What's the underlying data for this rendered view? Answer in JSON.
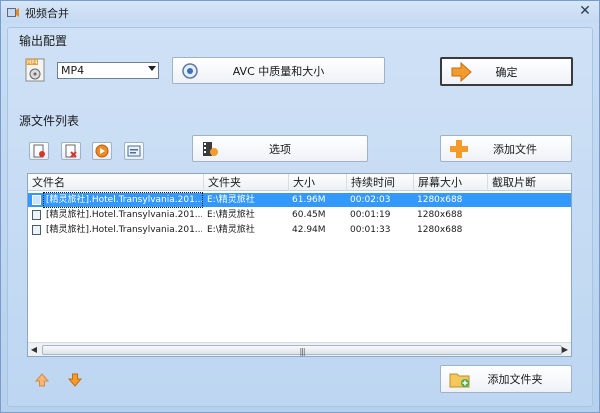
{
  "window": {
    "title": "视频合并"
  },
  "output": {
    "section_label": "输出配置",
    "format_value": "MP4",
    "quality_label": "AVC 中质量和大小",
    "confirm_label": "确定"
  },
  "sources": {
    "section_label": "源文件列表",
    "options_label": "选项",
    "add_file_label": "添加文件",
    "add_folder_label": "添加文件夹",
    "columns": [
      "文件名",
      "文件夹",
      "大小",
      "持续时间",
      "屏幕大小",
      "截取片断"
    ],
    "rows": [
      {
        "name": "[精灵旅社].Hotel.Transylvania.201...",
        "folder": "E:\\精灵旅社",
        "size": "61.96M",
        "duration": "00:02:03",
        "screen": "1280x688",
        "clip": ""
      },
      {
        "name": "[精灵旅社].Hotel.Transylvania.201...",
        "folder": "E:\\精灵旅社",
        "size": "60.45M",
        "duration": "00:01:19",
        "screen": "1280x688",
        "clip": ""
      },
      {
        "name": "[精灵旅社].Hotel.Transylvania.201...",
        "folder": "E:\\精灵旅社",
        "size": "42.94M",
        "duration": "00:01:33",
        "screen": "1280x688",
        "clip": ""
      }
    ],
    "selected_row": 0
  },
  "icons": {
    "app": "film-icon",
    "close": "close-icon",
    "format": "mp4-file-icon",
    "quality": "settings-disc-icon",
    "confirm": "arrow-right-icon",
    "options": "film-options-icon",
    "add_file": "plus-icon",
    "add_folder": "folder-add-icon",
    "toolbar": [
      "new-doc-icon",
      "remove-doc-icon",
      "play-icon",
      "info-icon"
    ],
    "move_up": "arrow-up-icon",
    "move_down": "arrow-down-icon"
  },
  "colors": {
    "accent_orange": "#f39c2b",
    "selection": "#3399ff",
    "window_bg": "#c9ddf5"
  }
}
